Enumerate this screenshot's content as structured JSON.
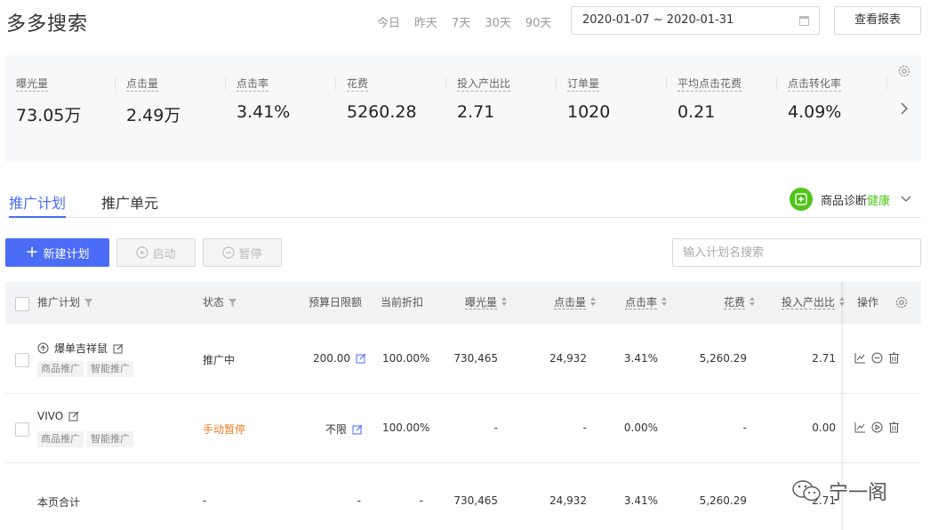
{
  "header": {
    "title": "多多搜索",
    "quick_dates": [
      "今日",
      "昨天",
      "7天",
      "30天",
      "90天"
    ],
    "date_range": "2020-01-07 ~ 2020-01-31",
    "report_button": "查看报表"
  },
  "metrics": [
    {
      "label": "曝光量",
      "value": "73.05万"
    },
    {
      "label": "点击量",
      "value": "2.49万"
    },
    {
      "label": "点击率",
      "value": "3.41%"
    },
    {
      "label": "花费",
      "value": "5260.28"
    },
    {
      "label": "投入产出比",
      "value": "2.71"
    },
    {
      "label": "订单量",
      "value": "1020"
    },
    {
      "label": "平均点击花费",
      "value": "0.21"
    },
    {
      "label": "点击转化率",
      "value": "4.09%"
    }
  ],
  "tabs": [
    "推广计划",
    "推广单元"
  ],
  "diagnosis": {
    "label": "商品诊断",
    "status": "健康"
  },
  "toolbar": {
    "new_plan": "新建计划",
    "start": "启动",
    "pause": "暂停",
    "search_placeholder": "输入计划名搜索"
  },
  "table": {
    "headers": {
      "plan": "推广计划",
      "status": "状态",
      "budget": "预算日限额",
      "discount": "当前折扣",
      "impressions": "曝光量",
      "clicks": "点击量",
      "ctr": "点击率",
      "cost": "花费",
      "roi": "投入产出比",
      "ops": "操作"
    },
    "rows": [
      {
        "name": "爆单吉祥鼠",
        "tags": [
          "商品推广",
          "智能推广"
        ],
        "status": "推广中",
        "budget": "200.00",
        "discount": "100.00%",
        "impressions": "730,465",
        "clicks": "24,932",
        "ctr": "3.41%",
        "cost": "5,260.29",
        "roi": "2.71"
      },
      {
        "name": "VIVO",
        "tags": [
          "商品推广",
          "智能推广"
        ],
        "status": "手动暂停",
        "budget": "不限",
        "discount": "100.00%",
        "impressions": "-",
        "clicks": "-",
        "ctr": "0.00%",
        "cost": "-",
        "roi": "0.00"
      }
    ],
    "total": {
      "label": "本页合计",
      "status": "-",
      "budget": "-",
      "discount": "-",
      "impressions": "730,465",
      "clicks": "24,932",
      "ctr": "3.41%",
      "cost": "5,260.29",
      "roi": "2.71"
    }
  },
  "watermark": "宁一阁",
  "colors": {
    "accent": "#4a6cf7",
    "healthy": "#52c41a",
    "paused": "#f07c1d"
  }
}
